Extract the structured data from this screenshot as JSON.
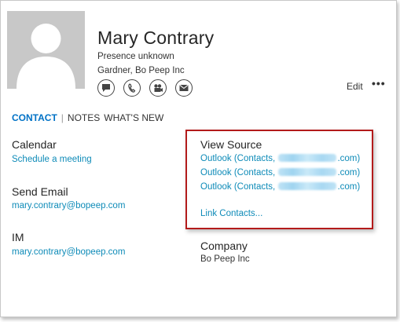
{
  "contact": {
    "name": "Mary Contrary",
    "presence": "Presence unknown",
    "title_company": "Gardner, Bo Peep Inc"
  },
  "actions": [
    {
      "icon": "chat-icon"
    },
    {
      "icon": "phone-icon"
    },
    {
      "icon": "video-icon"
    },
    {
      "icon": "email-icon"
    }
  ],
  "header": {
    "edit_label": "Edit",
    "more_label": "•••"
  },
  "tabs": [
    {
      "label": "CONTACT",
      "active": true
    },
    {
      "label": "NOTES",
      "active": false
    },
    {
      "label": "WHAT'S NEW",
      "active": false
    }
  ],
  "sections": {
    "calendar": {
      "title": "Calendar",
      "link": "Schedule a meeting"
    },
    "send_email": {
      "title": "Send Email",
      "link": "mary.contrary@bopeep.com"
    },
    "im": {
      "title": "IM",
      "link": "mary.contrary@bopeep.com"
    },
    "company": {
      "title": "Company",
      "value": "Bo Peep Inc"
    }
  },
  "view_source": {
    "title": "View Source",
    "sources": [
      {
        "prefix": "Outlook (Contacts, ",
        "suffix": ".com)"
      },
      {
        "prefix": "Outlook (Contacts, ",
        "suffix": ".com)"
      },
      {
        "prefix": "Outlook (Contacts, ",
        "suffix": ".com)"
      }
    ],
    "link_contacts": "Link Contacts..."
  },
  "colors": {
    "accent": "#0072c6",
    "link": "#0e8bb8",
    "highlight_border": "#b31b1b"
  }
}
